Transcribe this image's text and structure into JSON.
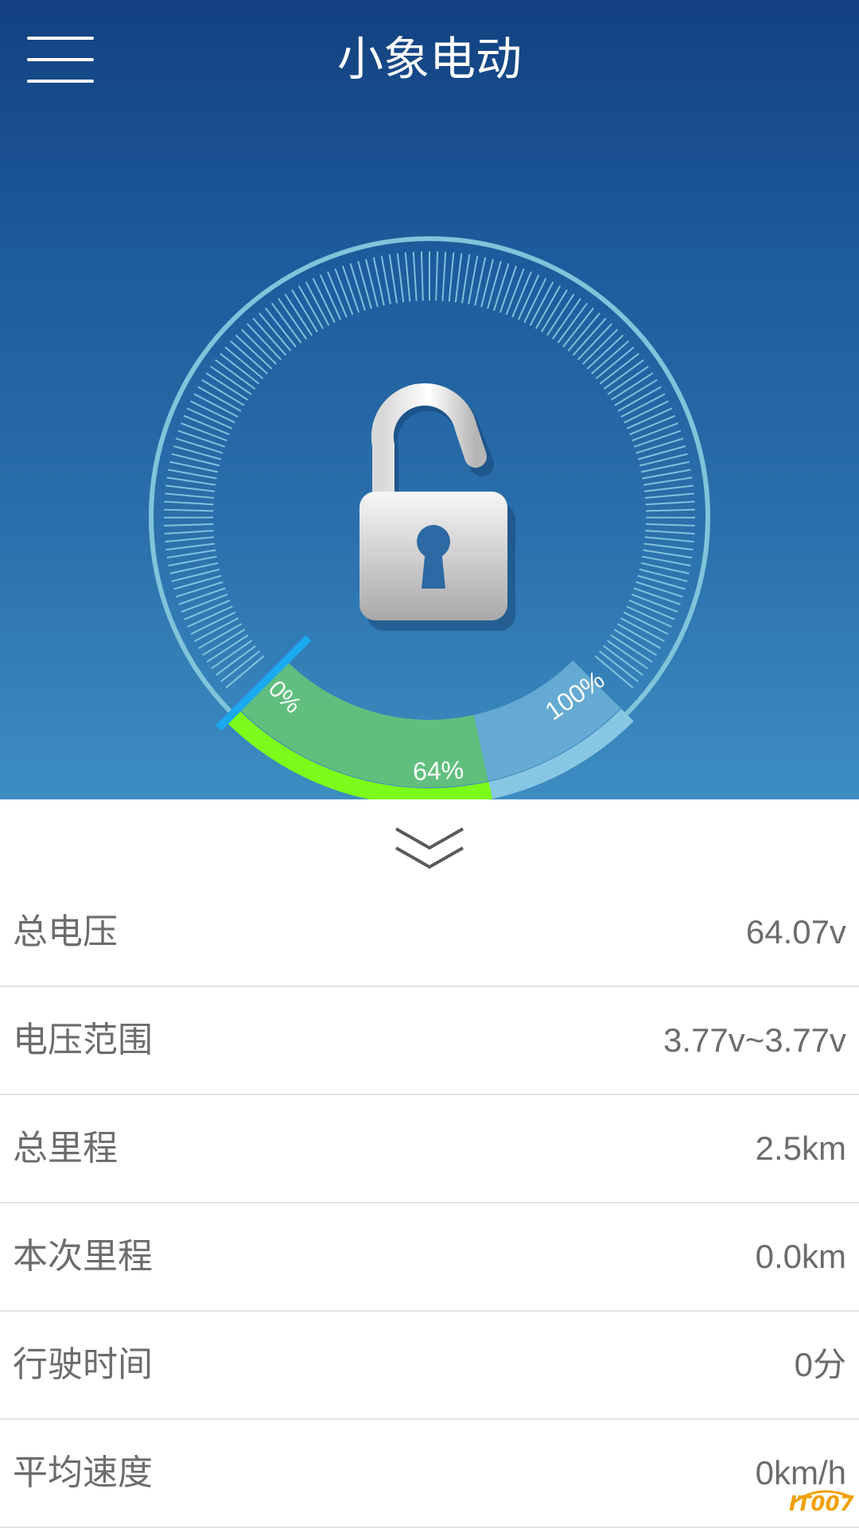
{
  "header": {
    "title": "小象电动"
  },
  "icons": {
    "menu": "menu-icon",
    "lock": "unlocked-padlock-icon",
    "expand": "double-chevron-down-icon"
  },
  "gauge": {
    "battery_percent": 64,
    "label_min": "0%",
    "label_current": "64%",
    "label_max": "100%",
    "lock_state": "unlocked"
  },
  "stats": [
    {
      "label": "总电压",
      "value": "64.07v"
    },
    {
      "label": "电压范围",
      "value": "3.77v~3.77v"
    },
    {
      "label": "总里程",
      "value": "2.5km"
    },
    {
      "label": "本次里程",
      "value": "0.0km"
    },
    {
      "label": "行驶时间",
      "value": "0分"
    },
    {
      "label": "平均速度",
      "value": "0km/h"
    }
  ],
  "watermark": {
    "text": "IT007"
  },
  "colors": {
    "header_top": "#13417f",
    "header_bottom": "#3d8dc2",
    "progress_fill": "#7cfc1a",
    "segment_filled": "#63c27a",
    "segment_remaining": "#88c7e3",
    "needle": "#1aa9f0",
    "ring": "#7fc4d9"
  }
}
